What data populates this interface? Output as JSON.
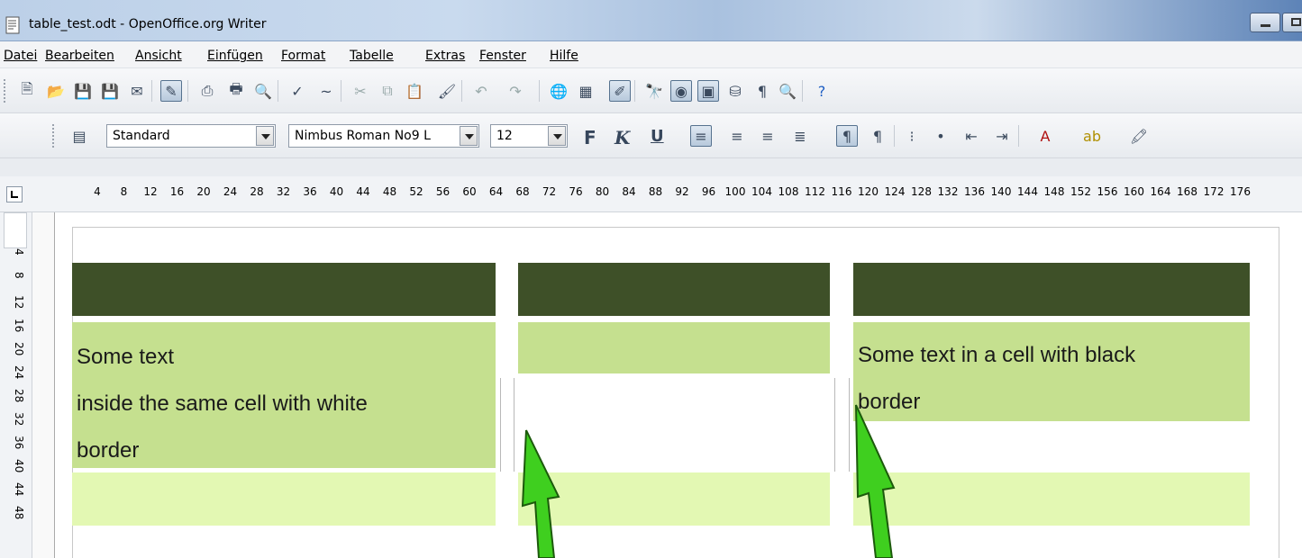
{
  "window": {
    "title": "table_test.odt - OpenOffice.org Writer"
  },
  "menu": {
    "items": [
      "Datei",
      "Bearbeiten",
      "Ansicht",
      "Einfügen",
      "Format",
      "Tabelle",
      "Extras",
      "Fenster",
      "Hilfe"
    ]
  },
  "formatting": {
    "paragraph_style": "Standard",
    "font_name": "Nimbus Roman No9 L",
    "font_size": "12",
    "bold_label": "F",
    "italic_label": "K",
    "underline_label": "U"
  },
  "ruler": {
    "ticks": [
      "4",
      "8",
      "12",
      "16",
      "20",
      "24",
      "28",
      "32",
      "36",
      "40",
      "44",
      "48",
      "52",
      "56",
      "60",
      "64",
      "68",
      "72",
      "76",
      "80",
      "84",
      "88",
      "92",
      "96",
      "100",
      "104",
      "108",
      "112",
      "116",
      "120",
      "124",
      "128",
      "132",
      "136",
      "140",
      "144",
      "148",
      "152",
      "156",
      "160",
      "164",
      "168",
      "172",
      "176"
    ],
    "vertical_ticks": [
      "4",
      "8",
      "12",
      "16",
      "20",
      "24",
      "28",
      "32",
      "36",
      "40",
      "44",
      "48"
    ]
  },
  "document": {
    "cell_left_text": [
      "Some text",
      "inside the same cell with white",
      "border"
    ],
    "cell_right_text": [
      "Some text in a cell with black",
      "border"
    ]
  },
  "colors": {
    "header_dark": "#3e5028",
    "cell_mid": "#c5e08f",
    "cell_light": "#e3f8b3",
    "arrow_green": "#44cc22"
  }
}
